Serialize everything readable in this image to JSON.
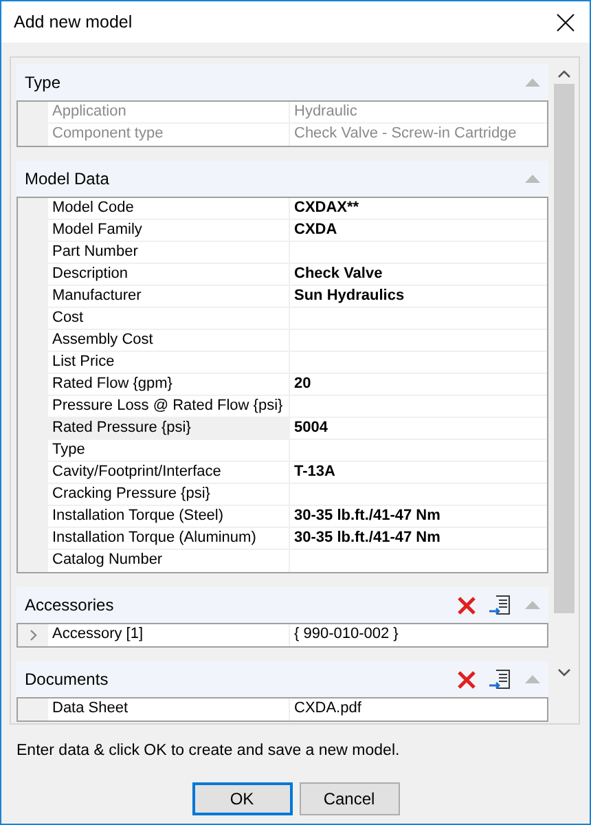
{
  "window": {
    "title": "Add new model"
  },
  "sections": [
    {
      "title": "Type",
      "actions": false,
      "rows": [
        {
          "label": "Application",
          "value": "Hydraulic",
          "disabled": true,
          "selected": false,
          "modified": false
        },
        {
          "label": "Component type",
          "value": "Check Valve - Screw-in Cartridge",
          "disabled": true,
          "selected": false,
          "modified": false
        }
      ]
    },
    {
      "title": "Model Data",
      "actions": false,
      "rows": [
        {
          "label": "Model Code",
          "value": "CXDAX**",
          "disabled": false,
          "selected": false,
          "modified": true
        },
        {
          "label": "Model Family",
          "value": "CXDA",
          "disabled": false,
          "selected": false,
          "modified": true
        },
        {
          "label": "Part Number",
          "disabled": false,
          "selected": false
        },
        {
          "label": "Description",
          "value": "Check Valve",
          "disabled": false,
          "selected": false,
          "modified": true
        },
        {
          "label": "Manufacturer",
          "value": "Sun Hydraulics",
          "disabled": false,
          "selected": false,
          "modified": true
        },
        {
          "label": "Cost",
          "disabled": false,
          "selected": false
        },
        {
          "label": "Assembly Cost",
          "disabled": false,
          "selected": false
        },
        {
          "label": "List Price",
          "disabled": false,
          "selected": false
        },
        {
          "label": "Rated Flow {gpm}",
          "value": "20",
          "disabled": false,
          "selected": false,
          "modified": true
        },
        {
          "label": "Pressure Loss @ Rated Flow {psi}",
          "disabled": false,
          "selected": false
        },
        {
          "label": "Rated Pressure {psi}",
          "value": "5004",
          "disabled": false,
          "selected": true,
          "modified": true
        },
        {
          "label": "Type",
          "disabled": false,
          "selected": false
        },
        {
          "label": "Cavity/Footprint/Interface",
          "value": "T-13A",
          "disabled": false,
          "selected": false,
          "modified": true
        },
        {
          "label": "Cracking Pressure {psi}",
          "disabled": false,
          "selected": false
        },
        {
          "label": "Installation Torque (Steel)",
          "value": "30-35 lb.ft./41-47 Nm",
          "disabled": false,
          "selected": false,
          "modified": true
        },
        {
          "label": "Installation Torque (Aluminum)",
          "value": "30-35 lb.ft./41-47 Nm",
          "disabled": false,
          "selected": false,
          "modified": true
        },
        {
          "label": "Catalog Number",
          "disabled": false,
          "selected": false
        }
      ]
    },
    {
      "title": "Accessories",
      "actions": true,
      "rows": [
        {
          "label": "Accessory [1]",
          "value": "{ 990-010-002 }",
          "disabled": false,
          "selected": false,
          "modified": false,
          "expandable": true
        }
      ]
    },
    {
      "title": "Documents",
      "actions": true,
      "rows": [
        {
          "label": "Data Sheet",
          "value": "CXDA.pdf",
          "disabled": false,
          "selected": false,
          "modified": false
        }
      ]
    }
  ],
  "status": "Enter data & click OK to create and save a new model.",
  "buttons": [
    {
      "label": "OK",
      "default": true
    },
    {
      "label": "Cancel",
      "default": false
    }
  ]
}
